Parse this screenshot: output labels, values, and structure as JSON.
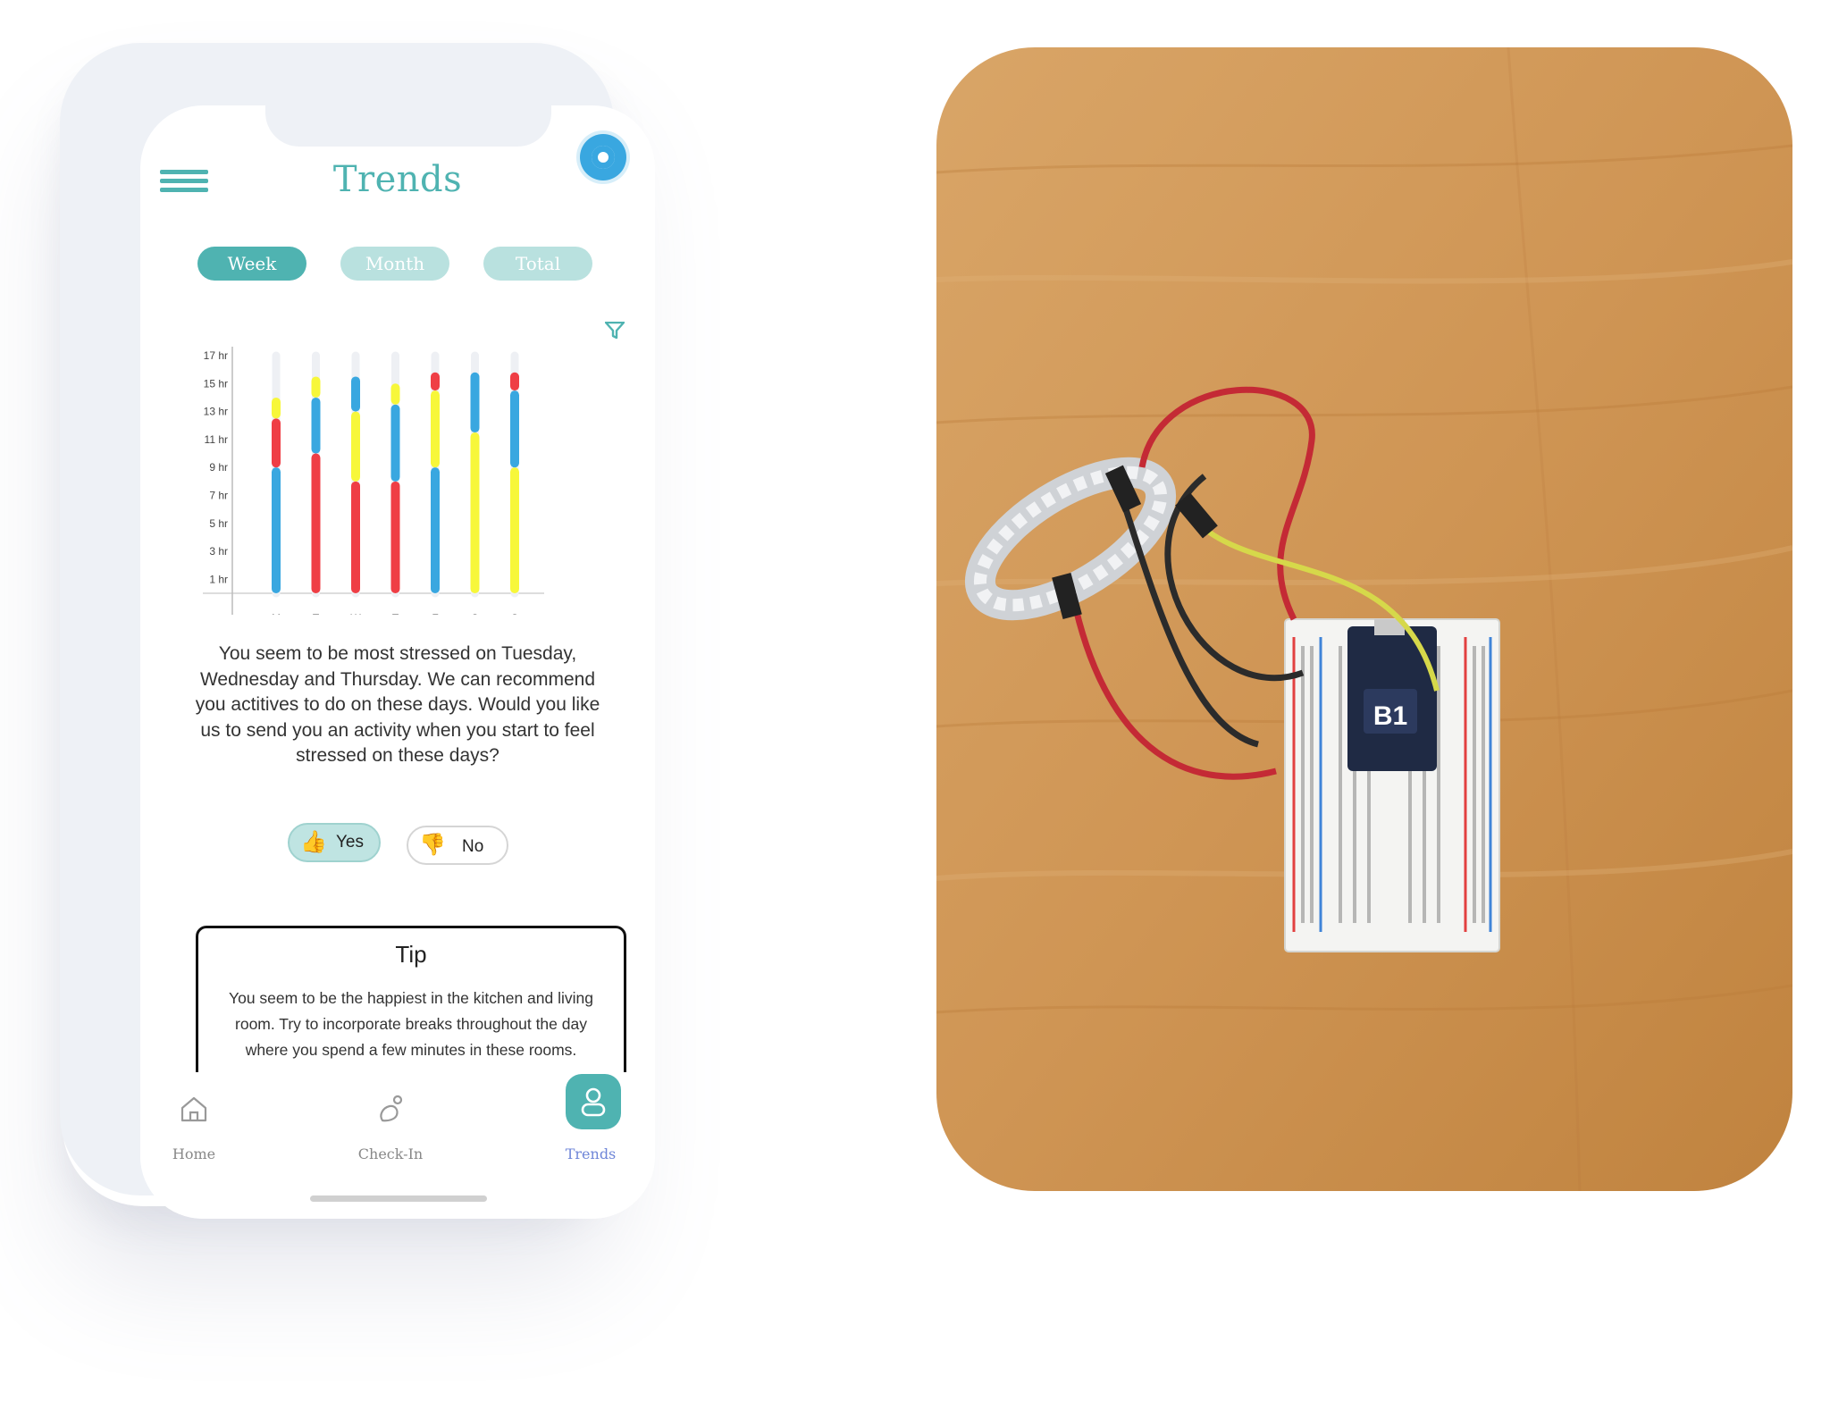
{
  "app": {
    "title": "Trends",
    "tabs": [
      {
        "label": "Week",
        "active": true
      },
      {
        "label": "Month",
        "active": false
      },
      {
        "label": "Total",
        "active": false
      }
    ]
  },
  "colors": {
    "accent": "#4fb3b1",
    "accent_light": "#b9e1df",
    "nav_active": "#6f86d8",
    "blue": "#39a7e0",
    "red": "#ef3e45",
    "yellow": "#f7f73a"
  },
  "chart_data": {
    "type": "bar",
    "stacked": true,
    "categories": [
      "M",
      "T",
      "W",
      "T",
      "F",
      "S",
      "S"
    ],
    "y_ticks": [
      "1 hr",
      "3 hr",
      "5 hr",
      "7 hr",
      "9 hr",
      "11 hr",
      "13 hr",
      "15 hr",
      "17 hr"
    ],
    "ylim": [
      0,
      17
    ],
    "segments": [
      [
        {
          "color": "blue",
          "from": 0,
          "to": 9
        },
        {
          "color": "red",
          "from": 9,
          "to": 12.5
        },
        {
          "color": "yellow",
          "from": 12.5,
          "to": 14
        }
      ],
      [
        {
          "color": "red",
          "from": 0,
          "to": 10
        },
        {
          "color": "blue",
          "from": 10,
          "to": 14
        },
        {
          "color": "yellow",
          "from": 14,
          "to": 15.5
        }
      ],
      [
        {
          "color": "red",
          "from": 0,
          "to": 8
        },
        {
          "color": "yellow",
          "from": 8,
          "to": 13
        },
        {
          "color": "blue",
          "from": 13,
          "to": 15.5
        }
      ],
      [
        {
          "color": "red",
          "from": 0,
          "to": 8
        },
        {
          "color": "blue",
          "from": 8,
          "to": 13.5
        },
        {
          "color": "yellow",
          "from": 13.5,
          "to": 15
        }
      ],
      [
        {
          "color": "blue",
          "from": 0,
          "to": 9
        },
        {
          "color": "yellow",
          "from": 9,
          "to": 14.5
        },
        {
          "color": "red",
          "from": 14.5,
          "to": 15.8
        }
      ],
      [
        {
          "color": "yellow",
          "from": 0,
          "to": 11.5
        },
        {
          "color": "blue",
          "from": 11.5,
          "to": 15.8
        }
      ],
      [
        {
          "color": "yellow",
          "from": 0,
          "to": 9
        },
        {
          "color": "blue",
          "from": 9,
          "to": 14.5
        },
        {
          "color": "red",
          "from": 14.5,
          "to": 15.8
        }
      ]
    ]
  },
  "question": {
    "text": "You seem to be most stressed on Tuesday, Wednesday and Thursday. We can recommend you actitives to do on these days. Would you like us to send you an activity when you start to feel stressed on these days?",
    "yes_label": "Yes",
    "no_label": "No",
    "yes_emoji": "👍",
    "no_emoji": "👎"
  },
  "tip": {
    "title": "Tip",
    "body": "You seem to be the happiest in the kitchen and living room. Try to incorporate breaks throughout the day where you spend a few minutes in these rooms."
  },
  "nav": {
    "items": [
      {
        "label": "Home",
        "icon": "home-icon"
      },
      {
        "label": "Check-In",
        "icon": "check-in-icon"
      },
      {
        "label": "Trends",
        "icon": "user-icon",
        "active": true
      }
    ]
  },
  "photo": {
    "board_label": "B1"
  }
}
